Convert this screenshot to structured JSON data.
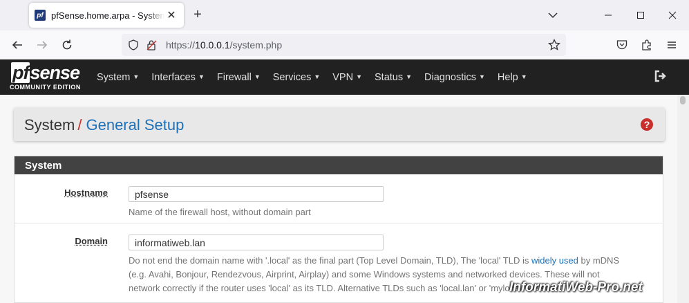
{
  "browser": {
    "tab_title": "pfSense.home.arpa - System: General Setup",
    "favicon_glyph": "pf",
    "url_prefix": "https://",
    "url_host": "10.0.0.1",
    "url_path": "/system.php"
  },
  "header": {
    "logo_main": "sense",
    "logo_pf": "pf",
    "logo_sub": "COMMUNITY EDITION",
    "menu": [
      {
        "label": "System"
      },
      {
        "label": "Interfaces"
      },
      {
        "label": "Firewall"
      },
      {
        "label": "Services"
      },
      {
        "label": "VPN"
      },
      {
        "label": "Status"
      },
      {
        "label": "Diagnostics"
      },
      {
        "label": "Help"
      }
    ]
  },
  "breadcrumb": {
    "root": "System",
    "separator": "/",
    "current": "General Setup",
    "help_glyph": "?"
  },
  "panel": {
    "title": "System",
    "hostname": {
      "label": "Hostname",
      "value": "pfsense",
      "help": "Name of the firewall host, without domain part"
    },
    "domain": {
      "label": "Domain",
      "value": "informatiweb.lan",
      "help_line1_a": "Do not end the domain name with '.local' as the final part (Top Level Domain, TLD), The 'local' TLD is ",
      "help_link": "widely used",
      "help_line1_b": " by mDNS",
      "help_line2": "(e.g. Avahi, Bonjour, Rendezvous, Airprint, Airplay) and some Windows systems and networked devices. These will not",
      "help_line3": "network correctly if the router uses 'local' as its TLD. Alternative TLDs such as 'local.lan' or 'mylocal' are safe."
    }
  },
  "watermark": "InformatiWeb-Pro.net",
  "colors": {
    "header_bg": "#212121",
    "panel_heading_bg": "#424242",
    "link": "#1f71b8",
    "danger": "#c9302c"
  }
}
